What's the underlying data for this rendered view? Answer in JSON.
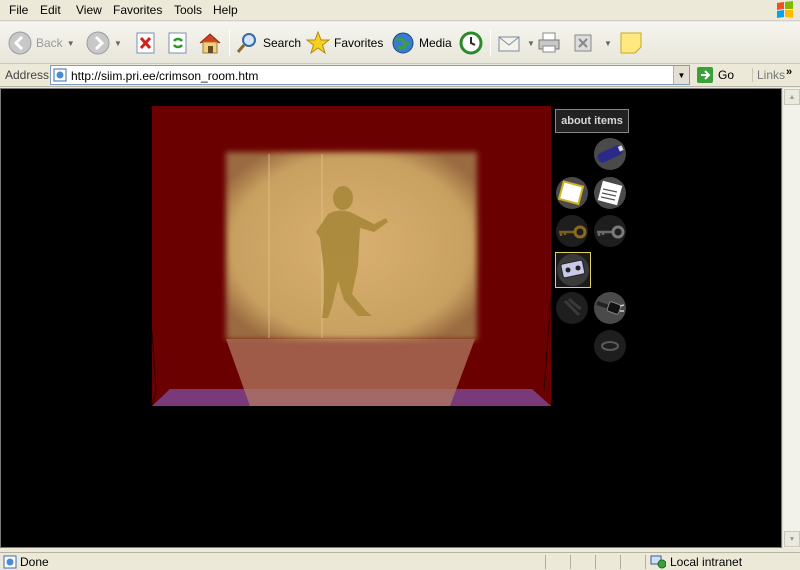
{
  "menu": [
    "File",
    "Edit",
    "View",
    "Favorites",
    "Tools",
    "Help"
  ],
  "toolbar": {
    "back_label": "Back",
    "search_label": "Search",
    "favorites_label": "Favorites",
    "media_label": "Media"
  },
  "address": {
    "label": "Address",
    "url": "http://siim.pri.ee/crimson_room.htm",
    "go_label": "Go",
    "links_label": "Links"
  },
  "game": {
    "about_label": "about items",
    "colors": {
      "wall": "#6b0000",
      "floor": "#7a3a7a",
      "screen": "#c8a060"
    },
    "items": [
      {
        "name": "battery",
        "selected": false
      },
      {
        "name": "note-paper",
        "selected": false
      },
      {
        "name": "memo",
        "selected": false
      },
      {
        "name": "gold-key",
        "selected": false
      },
      {
        "name": "silver-key",
        "selected": false
      },
      {
        "name": "video-tape",
        "selected": true
      },
      {
        "name": "dark-item",
        "selected": false
      },
      {
        "name": "power-plug",
        "selected": false
      },
      {
        "name": "ring",
        "selected": false
      }
    ]
  },
  "status": {
    "text": "Done",
    "zone": "Local intranet"
  }
}
